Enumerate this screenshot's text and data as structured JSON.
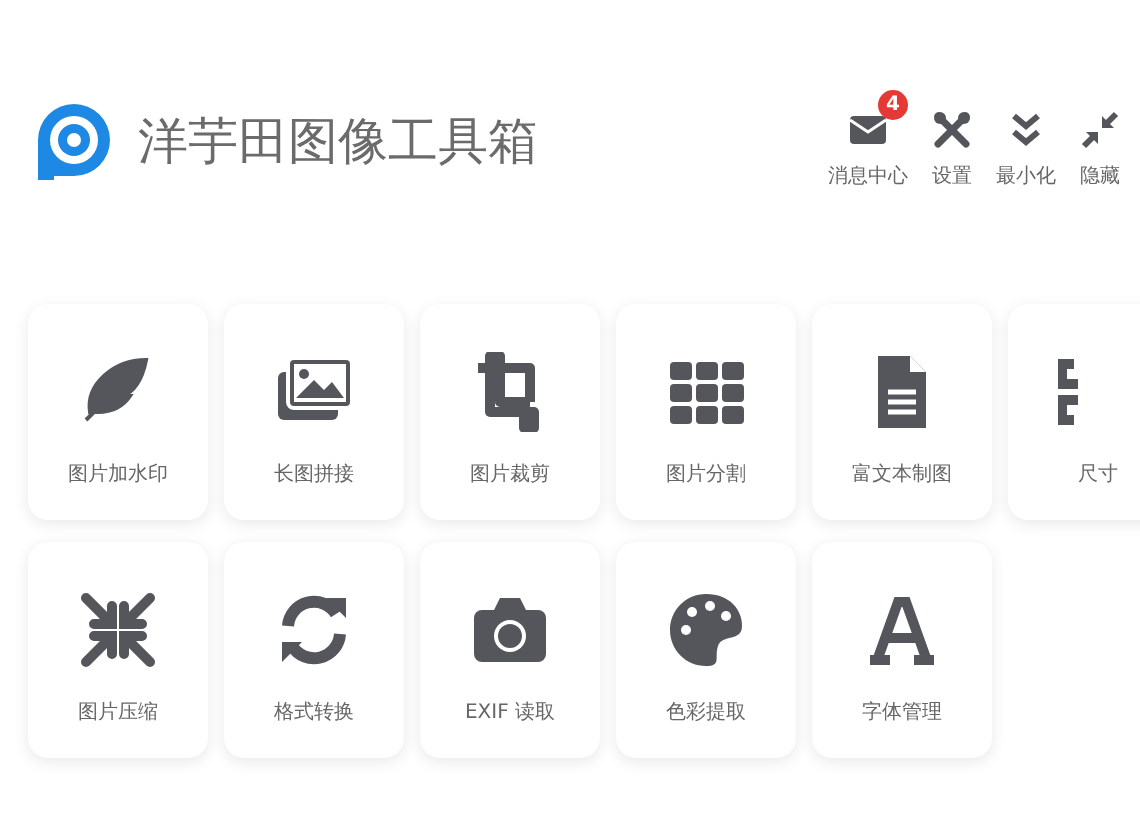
{
  "app": {
    "title": "洋芋田图像工具箱"
  },
  "toolbar": [
    {
      "kind": "messages",
      "label": "消息中心",
      "badge": "4"
    },
    {
      "kind": "settings",
      "label": "设置"
    },
    {
      "kind": "minimize",
      "label": "最小化"
    },
    {
      "kind": "hide",
      "label": "隐藏"
    }
  ],
  "tools": [
    [
      {
        "kind": "feather",
        "label": "图片加水印"
      },
      {
        "kind": "images",
        "label": "长图拼接"
      },
      {
        "kind": "crop",
        "label": "图片裁剪"
      },
      {
        "kind": "grid",
        "label": "图片分割"
      },
      {
        "kind": "document",
        "label": "富文本制图"
      },
      {
        "kind": "resize",
        "label": "尺寸"
      }
    ],
    [
      {
        "kind": "compress",
        "label": "图片压缩"
      },
      {
        "kind": "convert",
        "label": "格式转换"
      },
      {
        "kind": "camera",
        "label": "EXIF 读取"
      },
      {
        "kind": "palette",
        "label": "色彩提取"
      },
      {
        "kind": "font",
        "label": "字体管理"
      }
    ]
  ]
}
